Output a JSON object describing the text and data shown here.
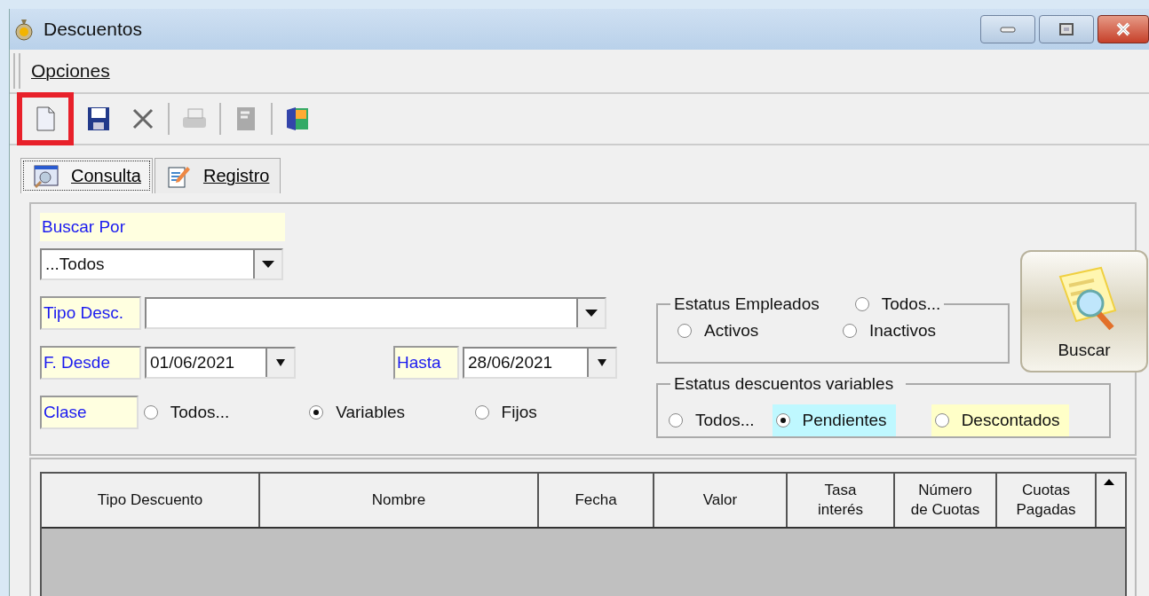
{
  "window": {
    "title": "Descuentos"
  },
  "menu": [
    {
      "label": "Opciones"
    }
  ],
  "toolbar": [
    {
      "kind": "new",
      "disabled": false,
      "highlighted": true
    },
    {
      "kind": "save",
      "disabled": false,
      "highlighted": false
    },
    {
      "kind": "delete",
      "disabled": false,
      "highlighted": false
    },
    {
      "kind": "separator"
    },
    {
      "kind": "print",
      "disabled": true,
      "highlighted": false
    },
    {
      "kind": "separator"
    },
    {
      "kind": "report",
      "disabled": true,
      "highlighted": false
    },
    {
      "kind": "separator"
    },
    {
      "kind": "exit",
      "disabled": false,
      "highlighted": false
    }
  ],
  "tabs": [
    {
      "label": "Consulta",
      "kind": "query",
      "selected": true
    },
    {
      "label": "Registro",
      "kind": "edit",
      "selected": false
    }
  ],
  "search": {
    "label": "Buscar Por",
    "value": "...Todos"
  },
  "tipo": {
    "label": "Tipo Desc."
  },
  "desde": {
    "label": "F. Desde",
    "value": "01/06/2021"
  },
  "hasta": {
    "label": "Hasta",
    "value": "28/06/2021"
  },
  "clase": {
    "label": "Clase",
    "options": [
      {
        "label": "Todos...",
        "selected": false
      },
      {
        "label": "Variables",
        "selected": true
      },
      {
        "label": "Fijos",
        "selected": false
      }
    ]
  },
  "empleados": {
    "title": "Estatus Empleados",
    "title_option": {
      "label": "Todos...",
      "selected": false
    },
    "options": [
      {
        "label": "Activos",
        "selected": false
      },
      {
        "label": "Inactivos",
        "selected": false
      }
    ]
  },
  "variables": {
    "title": "Estatus descuentos variables",
    "options": [
      {
        "label": "Todos...",
        "selected": false
      },
      {
        "label": "Pendientes",
        "selected": true,
        "color": "#bff8ff"
      },
      {
        "label": "Descontados",
        "selected": false,
        "color": "#ffffc8"
      }
    ]
  },
  "buscar_button": {
    "label": "Buscar"
  },
  "table": {
    "columns": [
      {
        "label": "Tipo Descuento"
      },
      {
        "label": "Nombre"
      },
      {
        "label": "Fecha"
      },
      {
        "label": "Valor"
      },
      {
        "label": "Tasa interés"
      },
      {
        "label": "Número de Cuotas"
      },
      {
        "label": "Cuotas Pagadas"
      }
    ]
  }
}
